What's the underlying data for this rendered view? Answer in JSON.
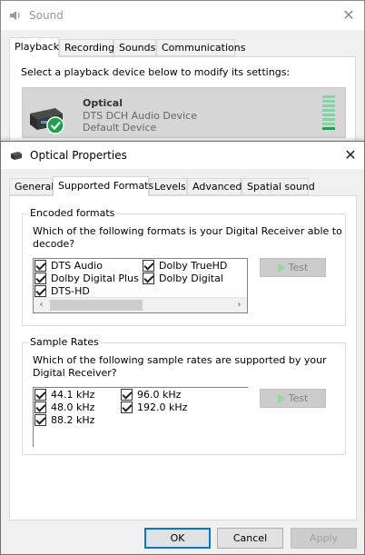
{
  "sound_window": {
    "title": "Sound",
    "close_glyph": "✕",
    "tabs": [
      {
        "label": "Playback",
        "active": true
      },
      {
        "label": "Recording",
        "active": false
      },
      {
        "label": "Sounds",
        "active": false
      },
      {
        "label": "Communications",
        "active": false
      }
    ],
    "instruction": "Select a playback device below to modify its settings:",
    "device": {
      "name": "Optical",
      "driver": "DTS DCH Audio Device",
      "status": "Default Device",
      "icon": "optical-receiver-icon",
      "badge_icon": "green-check-icon"
    }
  },
  "dialog": {
    "title": "Optical Properties",
    "close_glyph": "✕",
    "tabs": [
      {
        "label": "General",
        "active": false
      },
      {
        "label": "Supported Formats",
        "active": true
      },
      {
        "label": "Levels",
        "active": false
      },
      {
        "label": "Advanced",
        "active": false
      },
      {
        "label": "Spatial sound",
        "active": false
      }
    ],
    "encoded": {
      "group_label": "Encoded formats",
      "question_line1": "Which of the following formats is your Digital Receiver able to",
      "question_line2": "decode?",
      "formats": [
        {
          "label": "DTS Audio",
          "checked": true
        },
        {
          "label": "Dolby TrueHD",
          "checked": true
        },
        {
          "label": "Dolby Digital Plus",
          "checked": true
        },
        {
          "label": "Dolby Digital",
          "checked": true
        },
        {
          "label": "DTS-HD",
          "checked": true
        }
      ],
      "test_label": "Test",
      "scroll_left": "‹",
      "scroll_right": "›"
    },
    "sample_rates": {
      "group_label": "Sample Rates",
      "question_line1": "Which of the following sample rates are supported by your",
      "question_line2": "Digital Receiver?",
      "rates": [
        {
          "label": "44.1 kHz",
          "checked": true
        },
        {
          "label": "96.0 kHz",
          "checked": true
        },
        {
          "label": "48.0 kHz",
          "checked": true
        },
        {
          "label": "192.0 kHz",
          "checked": true
        },
        {
          "label": "88.2 kHz",
          "checked": true
        }
      ],
      "test_label": "Test"
    },
    "buttons": {
      "ok": "OK",
      "cancel": "Cancel",
      "apply": "Apply"
    }
  },
  "colors": {
    "accent": "#0078d7",
    "check_green": "#19a04b",
    "play_green": "#9ad4a6"
  }
}
